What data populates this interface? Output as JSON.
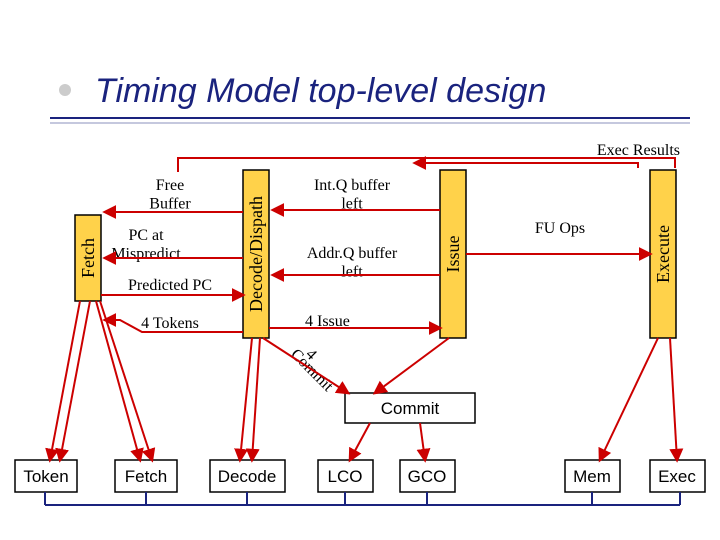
{
  "title": "Timing Model top-level design",
  "stages": {
    "fetch": "Fetch",
    "decode": "Decode/Dispath",
    "issue": "Issue",
    "execute": "Execute"
  },
  "labels": {
    "free_buffer": "Free\nBuffer",
    "pc_at_mispredict": "PC at\nMispredict",
    "predicted_pc": "Predicted PC",
    "four_tokens": "4 Tokens",
    "intq": "Int.Q buffer\nleft",
    "addrq": "Addr.Q buffer\nleft",
    "four_issue": "4 Issue",
    "four": "4",
    "commit_rotated": "Commit",
    "exec_results": "Exec Results",
    "fu_ops": "FU Ops",
    "commit_box": "Commit"
  },
  "bottom_boxes": {
    "token": "Token",
    "fetch": "Fetch",
    "decode": "Decode",
    "lco": "LCO",
    "gco": "GCO",
    "mem": "Mem",
    "exec": "Exec"
  }
}
